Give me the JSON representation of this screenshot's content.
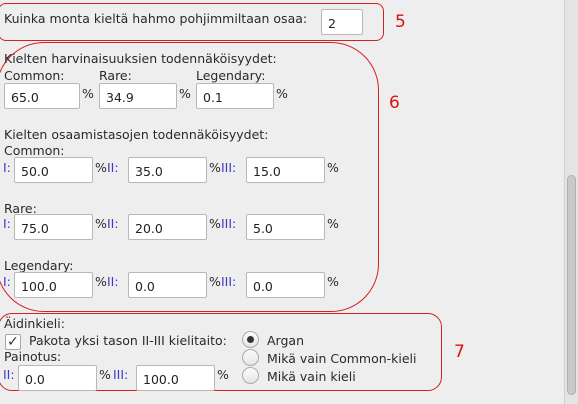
{
  "languages_count": {
    "label": "Kuinka monta kieltä hahmo pohjimmiltaan osaa:",
    "value": "2"
  },
  "rarity": {
    "title": "Kielten harvinaisuuksien todennäköisyydet:",
    "common_label": "Common:",
    "common_value": "65.0",
    "rare_label": "Rare:",
    "rare_value": "34.9",
    "legendary_label": "Legendary:",
    "legendary_value": "0.1"
  },
  "skill_levels": {
    "title": "Kielten osaamistasojen todennäköisyydet:",
    "groups": [
      {
        "label": "Common:",
        "i": "50.0",
        "ii": "35.0",
        "iii": "15.0"
      },
      {
        "label": "Rare:",
        "i": "75.0",
        "ii": "20.0",
        "iii": "5.0"
      },
      {
        "label": "Legendary:",
        "i": "100.0",
        "ii": "0.0",
        "iii": "0.0"
      }
    ]
  },
  "levels": {
    "i": "I:",
    "ii": "II:",
    "iii": "III:"
  },
  "percent": "%",
  "native": {
    "title": "Äidinkieli:",
    "force_label": "Pakota yksi tason II-III kielitaito:",
    "force_checked": true,
    "weight_label": "Painotus:",
    "weight_ii": "0.0",
    "weight_iii": "100.0",
    "options": [
      "Argan",
      "Mikä vain Common-kieli",
      "Mikä vain kieli"
    ],
    "selected_option": 0
  },
  "annotations": {
    "n5": "5",
    "n6": "6",
    "n7": "7"
  },
  "colors": {
    "annotation": "#e01010",
    "level_label": "#3c3cc8"
  }
}
